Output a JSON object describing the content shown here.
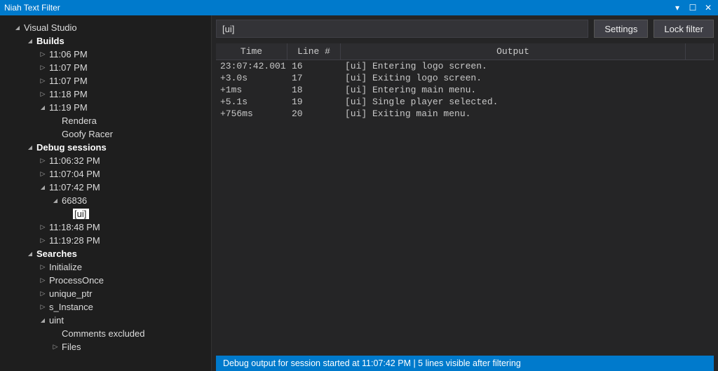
{
  "window": {
    "title": "Niah Text Filter"
  },
  "toolbar": {
    "filter_value": "[ui]",
    "settings_label": "Settings",
    "lock_label": "Lock filter"
  },
  "tree": [
    {
      "depth": 0,
      "exp": "down",
      "label": "Visual Studio",
      "bold": false
    },
    {
      "depth": 1,
      "exp": "down",
      "label": "Builds",
      "bold": true
    },
    {
      "depth": 2,
      "exp": "right",
      "label": "11:06 PM",
      "bold": false
    },
    {
      "depth": 2,
      "exp": "right",
      "label": "11:07 PM",
      "bold": false
    },
    {
      "depth": 2,
      "exp": "right",
      "label": "11:07 PM",
      "bold": false
    },
    {
      "depth": 2,
      "exp": "right",
      "label": "11:18 PM",
      "bold": false
    },
    {
      "depth": 2,
      "exp": "down",
      "label": "11:19 PM",
      "bold": false
    },
    {
      "depth": 3,
      "exp": "empty",
      "label": "Rendera",
      "bold": false
    },
    {
      "depth": 3,
      "exp": "empty",
      "label": "Goofy Racer",
      "bold": false
    },
    {
      "depth": 1,
      "exp": "down",
      "label": "Debug sessions",
      "bold": true
    },
    {
      "depth": 2,
      "exp": "right",
      "label": "11:06:32 PM",
      "bold": false
    },
    {
      "depth": 2,
      "exp": "right",
      "label": "11:07:04 PM",
      "bold": false
    },
    {
      "depth": 2,
      "exp": "down",
      "label": "11:07:42 PM",
      "bold": false
    },
    {
      "depth": 3,
      "exp": "down",
      "label": "66836",
      "bold": false
    },
    {
      "depth": 4,
      "exp": "empty",
      "label": "[ui]",
      "bold": false,
      "selected": true
    },
    {
      "depth": 2,
      "exp": "right",
      "label": "11:18:48 PM",
      "bold": false
    },
    {
      "depth": 2,
      "exp": "right",
      "label": "11:19:28 PM",
      "bold": false
    },
    {
      "depth": 1,
      "exp": "down",
      "label": "Searches",
      "bold": true
    },
    {
      "depth": 2,
      "exp": "right",
      "label": "Initialize",
      "bold": false
    },
    {
      "depth": 2,
      "exp": "right",
      "label": "ProcessOnce",
      "bold": false
    },
    {
      "depth": 2,
      "exp": "right",
      "label": "unique_ptr",
      "bold": false
    },
    {
      "depth": 2,
      "exp": "right",
      "label": "s_Instance",
      "bold": false
    },
    {
      "depth": 2,
      "exp": "down",
      "label": "uint",
      "bold": false
    },
    {
      "depth": 3,
      "exp": "empty",
      "label": "Comments excluded",
      "bold": false
    },
    {
      "depth": 3,
      "exp": "right",
      "label": "Files",
      "bold": false
    }
  ],
  "columns": {
    "time": "Time",
    "line": "Line #",
    "output": "Output"
  },
  "rows": [
    {
      "time": "23:07:42.001",
      "line": "16",
      "output": "[ui] Entering logo screen."
    },
    {
      "time": "+3.0s",
      "line": "17",
      "output": "[ui] Exiting logo screen."
    },
    {
      "time": "+1ms",
      "line": "18",
      "output": "[ui] Entering main menu."
    },
    {
      "time": "+5.1s",
      "line": "19",
      "output": "[ui] Single player selected."
    },
    {
      "time": "+756ms",
      "line": "20",
      "output": "[ui] Exiting main menu."
    }
  ],
  "status": "Debug output for session started at 11:07:42 PM  |  5 lines visible after filtering"
}
